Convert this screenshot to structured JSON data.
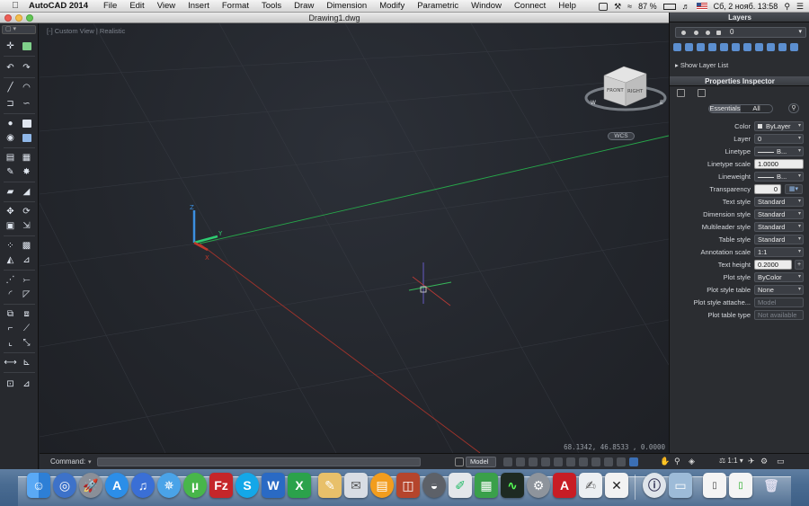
{
  "menubar": {
    "app_name": "AutoCAD 2014",
    "menus": [
      "File",
      "Edit",
      "View",
      "Insert",
      "Format",
      "Tools",
      "Draw",
      "Dimension",
      "Modify",
      "Parametric",
      "Window",
      "Connect",
      "Help"
    ],
    "battery": "87 %",
    "clock": "Сб, 2 нояб.  13:58"
  },
  "window": {
    "title": "Drawing1.dwg",
    "view_label": "[-] Custom View | Realistic",
    "wcs_label": "WCS",
    "coords": "68.1342,   46.8533 , 0.0000",
    "viewcube": {
      "front": "FRONT",
      "right": "RIGHT"
    }
  },
  "command": {
    "label": "Command:",
    "value": ""
  },
  "status": {
    "model": "Model",
    "scale": "1:1"
  },
  "layers_panel": {
    "title": "Layers",
    "current_layer": "0",
    "show_layer_list": "Show Layer List"
  },
  "inspector": {
    "title": "Properties Inspector",
    "tabs": [
      "Essentials",
      "All"
    ],
    "rows": [
      {
        "label": "Color",
        "value": "ByLayer"
      },
      {
        "label": "Layer",
        "value": "0"
      },
      {
        "label": "Linetype",
        "value": "B..."
      },
      {
        "label": "Linetype scale",
        "value": "1.0000"
      },
      {
        "label": "Lineweight",
        "value": "B..."
      },
      {
        "label": "Transparency",
        "value": "0"
      },
      {
        "label": "Text style",
        "value": "Standard"
      },
      {
        "label": "Dimension style",
        "value": "Standard"
      },
      {
        "label": "Multileader style",
        "value": "Standard"
      },
      {
        "label": "Table style",
        "value": "Standard"
      },
      {
        "label": "Annotation scale",
        "value": "1:1"
      },
      {
        "label": "Text height",
        "value": "0.2000"
      },
      {
        "label": "Plot style",
        "value": "ByColor"
      },
      {
        "label": "Plot style table",
        "value": "None"
      },
      {
        "label": "Plot style attache...",
        "value": "Model"
      },
      {
        "label": "Plot table type",
        "value": "Not available"
      }
    ]
  },
  "colors": {
    "x_axis": "#c0392b",
    "y_axis": "#2ecc71",
    "z_axis": "#3b8fe0",
    "viewport_bg": "#23262c"
  },
  "icons": [
    "apple-icon",
    "wifi-icon",
    "volume-icon",
    "search-icon",
    "list-icon"
  ],
  "dock": {
    "apps": [
      "Finder",
      "Dashboard",
      "Launchpad",
      "App Store",
      "iTunes",
      "Safari",
      "uTorrent",
      "FileZilla",
      "Skype",
      "Word",
      "Excel",
      "Notes",
      "Mail",
      "iBooks",
      "Photo Booth",
      "Disk Utility",
      "Pages",
      "Photos",
      "Activity Monitor",
      "System Preferences",
      "AutoCAD",
      "TextEdit",
      "Terminal",
      "Unknown",
      "Downloads",
      "Document",
      "Torrent",
      "Trash"
    ]
  }
}
